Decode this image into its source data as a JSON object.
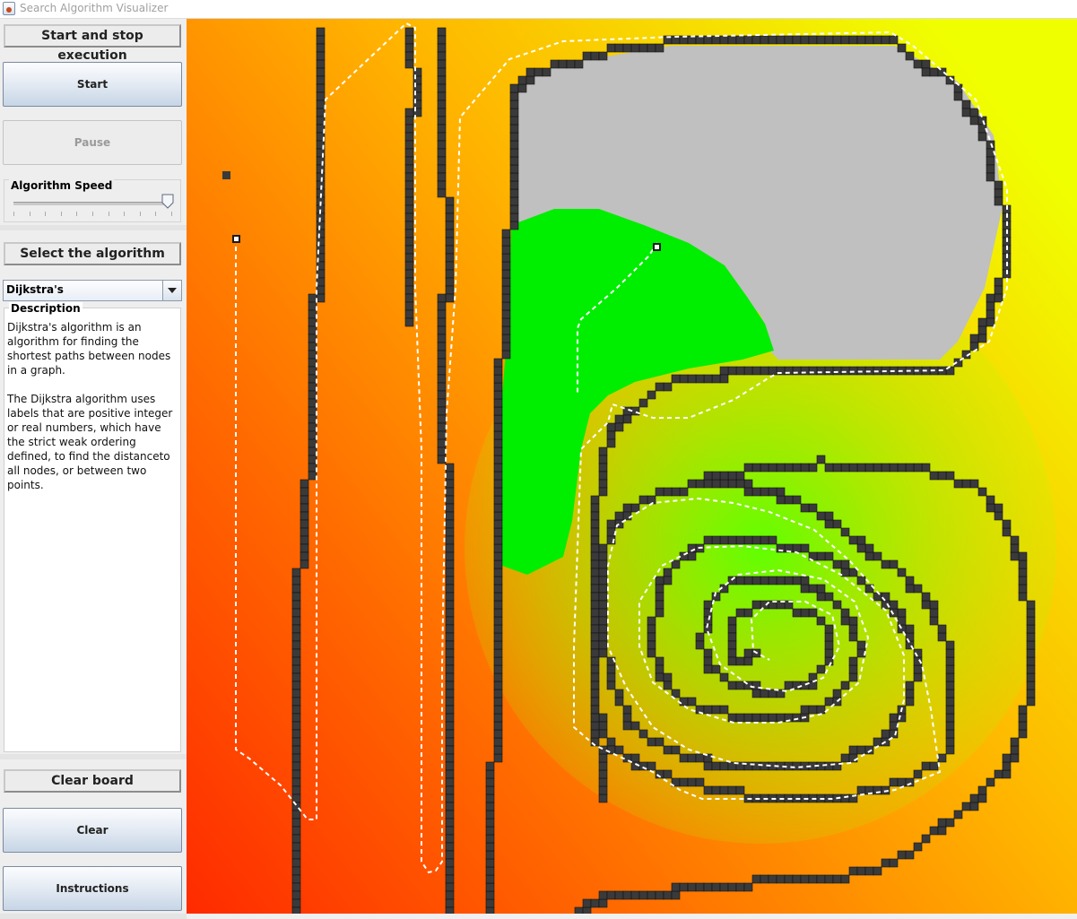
{
  "window": {
    "title": "Search Algorithm Visualizer",
    "app_icon": "java-cup-icon"
  },
  "execution": {
    "header": "Start and stop execution",
    "start_label": "Start",
    "pause_label": "Pause",
    "pause_enabled": false,
    "speed": {
      "label": "Algorithm Speed",
      "value_fraction": 0.98
    }
  },
  "algorithm": {
    "header": "Select the algorithm",
    "selected": "Dijkstra's",
    "description_label": "Description",
    "description": "Dijkstra's algorithm is an algorithm for finding the shortest paths between nodes in a graph.\n\nThe Dijkstra algorithm uses labels that are positive integer or real numbers, which have the strict weak ordering defined, to find the distanceto all nodes, or between two points."
  },
  "board_controls": {
    "header": "Clear board",
    "clear_label": "Clear",
    "instructions_label": "Instructions"
  },
  "grid": {
    "colors": {
      "start_heat": "#ff2a00",
      "mid_heat": "#ffb400",
      "far_heat": "#f0ff00",
      "green_zone": "#00ee00",
      "wall": "#3a3a3a",
      "unvisited": "#c0c0c0",
      "path": "#ffffff"
    }
  }
}
